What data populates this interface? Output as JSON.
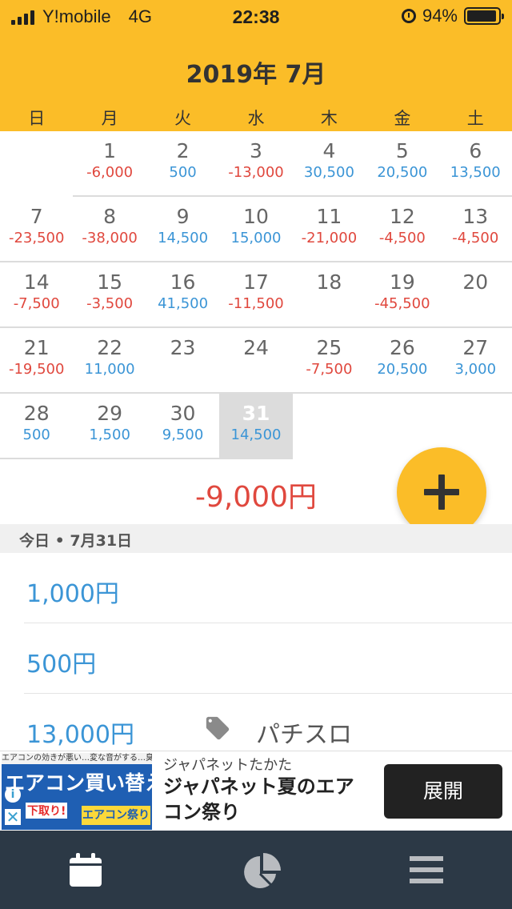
{
  "status_bar": {
    "carrier": "Y!mobile",
    "network": "4G",
    "time": "22:38",
    "battery": "94%"
  },
  "header": {
    "month_title": "2019年 7月",
    "weekdays": [
      "日",
      "月",
      "火",
      "水",
      "木",
      "金",
      "土"
    ]
  },
  "calendar": {
    "weeks": [
      [
        null,
        {
          "day": "1",
          "amount": "-6,000",
          "type": "expense"
        },
        {
          "day": "2",
          "amount": "500",
          "type": "income"
        },
        {
          "day": "3",
          "amount": "-13,000",
          "type": "expense"
        },
        {
          "day": "4",
          "amount": "30,500",
          "type": "income"
        },
        {
          "day": "5",
          "amount": "20,500",
          "type": "income"
        },
        {
          "day": "6",
          "amount": "13,500",
          "type": "income"
        }
      ],
      [
        {
          "day": "7",
          "amount": "-23,500",
          "type": "expense"
        },
        {
          "day": "8",
          "amount": "-38,000",
          "type": "expense"
        },
        {
          "day": "9",
          "amount": "14,500",
          "type": "income"
        },
        {
          "day": "10",
          "amount": "15,000",
          "type": "income"
        },
        {
          "day": "11",
          "amount": "-21,000",
          "type": "expense"
        },
        {
          "day": "12",
          "amount": "-4,500",
          "type": "expense"
        },
        {
          "day": "13",
          "amount": "-4,500",
          "type": "expense"
        }
      ],
      [
        {
          "day": "14",
          "amount": "-7,500",
          "type": "expense"
        },
        {
          "day": "15",
          "amount": "-3,500",
          "type": "expense"
        },
        {
          "day": "16",
          "amount": "41,500",
          "type": "income"
        },
        {
          "day": "17",
          "amount": "-11,500",
          "type": "expense"
        },
        {
          "day": "18",
          "amount": "",
          "type": "none"
        },
        {
          "day": "19",
          "amount": "-45,500",
          "type": "expense"
        },
        {
          "day": "20",
          "amount": "",
          "type": "none"
        }
      ],
      [
        {
          "day": "21",
          "amount": "-19,500",
          "type": "expense"
        },
        {
          "day": "22",
          "amount": "11,000",
          "type": "income"
        },
        {
          "day": "23",
          "amount": "",
          "type": "none"
        },
        {
          "day": "24",
          "amount": "",
          "type": "none"
        },
        {
          "day": "25",
          "amount": "-7,500",
          "type": "expense"
        },
        {
          "day": "26",
          "amount": "20,500",
          "type": "income"
        },
        {
          "day": "27",
          "amount": "3,000",
          "type": "income"
        }
      ],
      [
        {
          "day": "28",
          "amount": "500",
          "type": "income"
        },
        {
          "day": "29",
          "amount": "1,500",
          "type": "income"
        },
        {
          "day": "30",
          "amount": "9,500",
          "type": "income"
        },
        {
          "day": "31",
          "amount": "14,500",
          "type": "income",
          "today": true
        },
        null,
        null,
        null
      ]
    ]
  },
  "summary": {
    "total": "-9,000円"
  },
  "day_section": {
    "header": "今日 • 7月31日",
    "entries": [
      {
        "amount": "1,000円",
        "category": ""
      },
      {
        "amount": "500円",
        "category": ""
      },
      {
        "amount": "13,000円",
        "category": "パチスロ"
      }
    ]
  },
  "ad": {
    "image_top_text": "エアコンの効きが悪い…変な音がする…臭い…",
    "image_big_text": "エアコン買い替え応援",
    "image_red_text": "下取り!",
    "image_ribbon_text": "エアコン祭り",
    "sponsor": "ジャパネットたかた",
    "headline": "ジャパネット夏のエアコン祭り",
    "button_label": "展開"
  },
  "colors": {
    "accent": "#fbbd28",
    "expense": "#e0483e",
    "income": "#3b95d6",
    "tab_bar": "#2c3946"
  }
}
